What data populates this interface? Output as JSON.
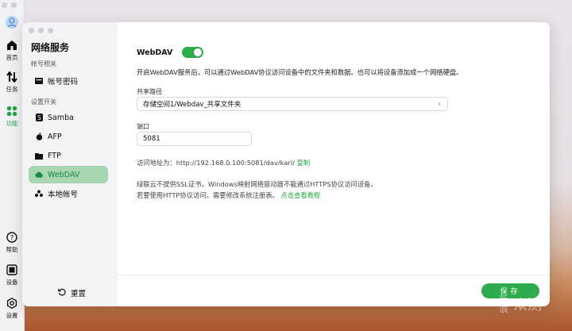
{
  "rail": {
    "items": [
      {
        "label": "首页",
        "icon": "home-icon"
      },
      {
        "label": "任务",
        "icon": "transfer-icon"
      },
      {
        "label": "功能",
        "icon": "apps-icon",
        "active": true
      },
      {
        "label": "帮助",
        "icon": "help-icon"
      },
      {
        "label": "设备",
        "icon": "device-icon"
      },
      {
        "label": "设置",
        "icon": "gear-icon"
      }
    ]
  },
  "sidebar": {
    "title": "网络服务",
    "sections": [
      "帐号相关",
      "设置开关"
    ],
    "items": [
      {
        "label": "帐号密码",
        "icon": "card-icon"
      },
      {
        "label": "Samba",
        "icon": "samba-icon"
      },
      {
        "label": "AFP",
        "icon": "apple-icon"
      },
      {
        "label": "FTP",
        "icon": "folder-icon"
      },
      {
        "label": "WebDAV",
        "icon": "cloud-icon",
        "active": true
      },
      {
        "label": "本地帐号",
        "icon": "users-icon"
      }
    ],
    "reset_label": "重置"
  },
  "main": {
    "service_name": "WebDAV",
    "enabled": true,
    "description": "开启WebDAV服务后，可以通过WebDAV协议访问设备中的文件夹和数据。也可以将设备添加成一个网络硬盘。",
    "share_path_label": "共享路径",
    "share_path_value": "存储空间1/Webdav_共享文件夹",
    "port_label": "端口",
    "port_value": "5081",
    "address_prefix": "访问地址为：http://192.168.0.100:5081/dav/karl/",
    "copy_label": "复制",
    "note_line1": "绿联云不提供SSL证书，Windows映射网络驱动器不能通过HTTPS协议访问设备。",
    "note_line2_prefix": "若要使用HTTP协议访问，需要修改系统注册表。",
    "tutorial_link": "点击查看教程",
    "save_label": "保存"
  },
  "watermark": {
    "text_small": "新浪",
    "text_large": "众测"
  },
  "colors": {
    "accent": "#2eab4c",
    "active_bg": "#a8d6b2"
  }
}
